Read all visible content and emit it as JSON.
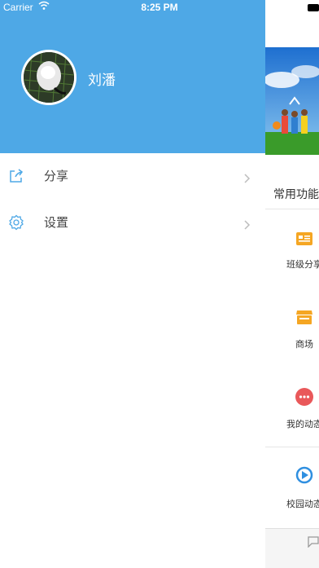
{
  "status_bar": {
    "carrier": "Carrier",
    "time": "8:25 PM"
  },
  "drawer": {
    "user_name": "刘潘",
    "menu": [
      {
        "label": "分享",
        "icon": "share-icon"
      },
      {
        "label": "设置",
        "icon": "gear-icon"
      }
    ]
  },
  "main": {
    "section_title": "常用功能",
    "functions": [
      {
        "label": "班级分享",
        "icon": "news-icon",
        "color": "#f5a623"
      },
      {
        "label": "商场",
        "icon": "store-icon",
        "color": "#f5a623"
      },
      {
        "label": "我的动态",
        "icon": "chat-bubble-icon",
        "color": "#e9585a"
      },
      {
        "label": "校园动态",
        "icon": "play-circle-icon",
        "color": "#2f8fe0"
      }
    ]
  },
  "colors": {
    "header_bg": "#4ea8e6",
    "accent": "#4ea8e6"
  }
}
